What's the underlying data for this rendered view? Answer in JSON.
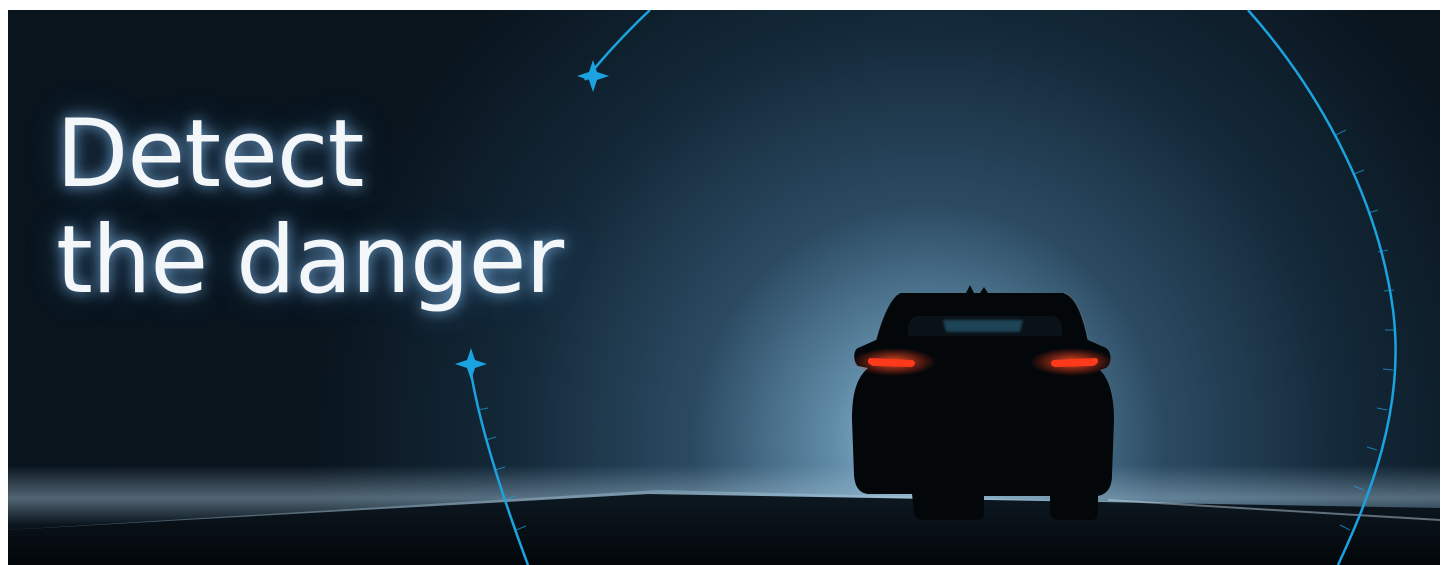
{
  "headline": {
    "line1": "Detect",
    "line2": "the danger"
  },
  "colors": {
    "background": "#0b1a26",
    "accent": "#1aa3e0",
    "tail_light": "#ff3a1a",
    "headline_text": "#f4f7fa"
  },
  "icons": [
    "sparkle-star-icon",
    "sparkle-star-icon"
  ]
}
